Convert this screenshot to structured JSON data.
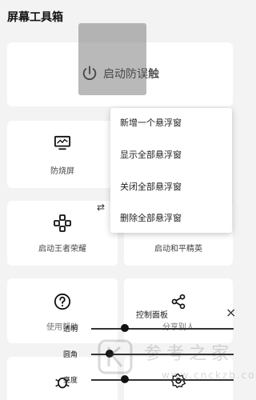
{
  "header": {
    "title": "屏幕工具箱"
  },
  "main_action": {
    "label": "启动防误触",
    "icon": "power-icon"
  },
  "tiles": [
    {
      "label": "防烧屏",
      "icon": "monitor-icon"
    },
    {
      "label": "启动王者荣耀",
      "icon": "gamepad-icon"
    },
    {
      "label": "启动和平精英",
      "icon": ""
    },
    {
      "label": "使用帮助",
      "icon": "help-circle-icon"
    },
    {
      "label": "分享别人",
      "icon": "share-icon"
    },
    {
      "label": "",
      "icon": "bug-icon"
    },
    {
      "label": "",
      "icon": "settings-icon"
    }
  ],
  "swap_glyph": "⇄",
  "popup_menu": {
    "items": [
      "新增一个悬浮窗",
      "显示全部悬浮窗",
      "关闭全部悬浮窗",
      "删除全部悬浮窗"
    ]
  },
  "control_panel": {
    "title": "控制面板",
    "close_glyph": "×",
    "sliders": [
      {
        "label": "透明",
        "value": 0.22
      },
      {
        "label": "圆角",
        "value": 0.11
      },
      {
        "label": "亮度",
        "value": 0.22
      }
    ]
  },
  "watermark": {
    "text": "参考之家",
    "url": "www.cnckzb.com"
  }
}
